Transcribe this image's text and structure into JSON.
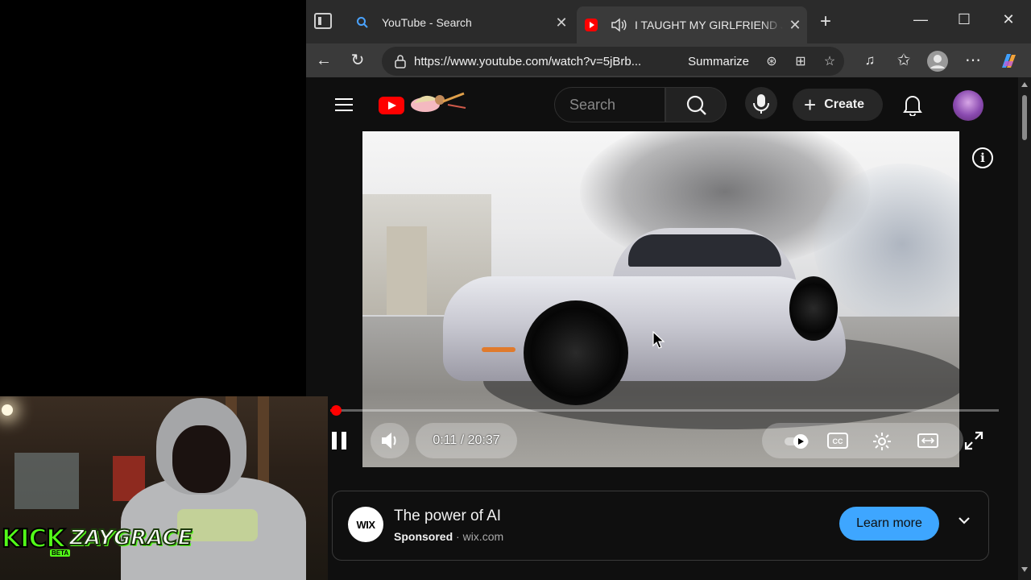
{
  "browser": {
    "tabs": [
      {
        "title": "YouTube - Search",
        "favicon": "search-icon",
        "active": false
      },
      {
        "title": "I TAUGHT MY GIRLFRIEND JA",
        "favicon": "youtube-icon",
        "active": true,
        "audio": "speaker-icon"
      }
    ],
    "address_url": "https://www.youtube.com/watch?v=5jBrb...",
    "summarize_label": "Summarize"
  },
  "youtube": {
    "search_placeholder": "Search",
    "create_label": "Create",
    "player": {
      "current_time": "0:11",
      "duration": "20:37",
      "time_display": "0:11 / 20:37",
      "progress_fraction": 0.009
    },
    "ad": {
      "logo_text": "WIX",
      "title": "The power of AI",
      "sponsored_label": "Sponsored",
      "separator": "·",
      "domain": "wix.com",
      "cta_label": "Learn more"
    }
  },
  "stream_overlay": {
    "kick_label": "KICK",
    "beta_label": "BETA",
    "streamer_name": "ZAYGRACE"
  },
  "colors": {
    "youtube_red": "#ff0000",
    "learn_more_blue": "#3ea6ff",
    "kick_green": "#53fc18",
    "page_background": "#0f0f0f"
  }
}
